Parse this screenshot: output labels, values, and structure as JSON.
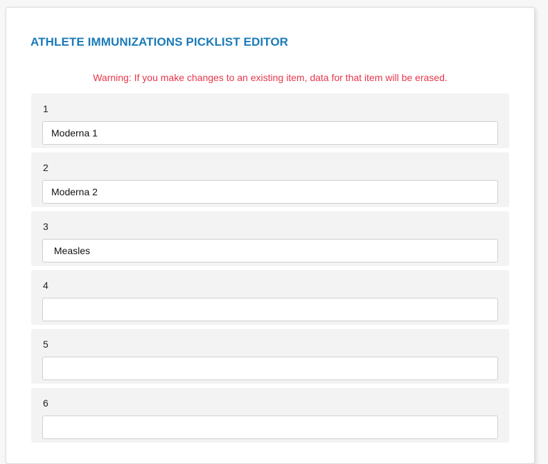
{
  "page": {
    "title": "ATHLETE IMMUNIZATIONS PICKLIST EDITOR",
    "warning": "Warning: If you make changes to an existing item, data for that item will be erased."
  },
  "items": [
    {
      "number": "1",
      "value": "Moderna 1"
    },
    {
      "number": "2",
      "value": "Moderna 2"
    },
    {
      "number": "3",
      "value": " Measles"
    },
    {
      "number": "4",
      "value": ""
    },
    {
      "number": "5",
      "value": ""
    },
    {
      "number": "6",
      "value": ""
    }
  ],
  "colors": {
    "title": "#1a7ab8",
    "warning": "#e8354a",
    "item_background": "#f3f3f3"
  }
}
